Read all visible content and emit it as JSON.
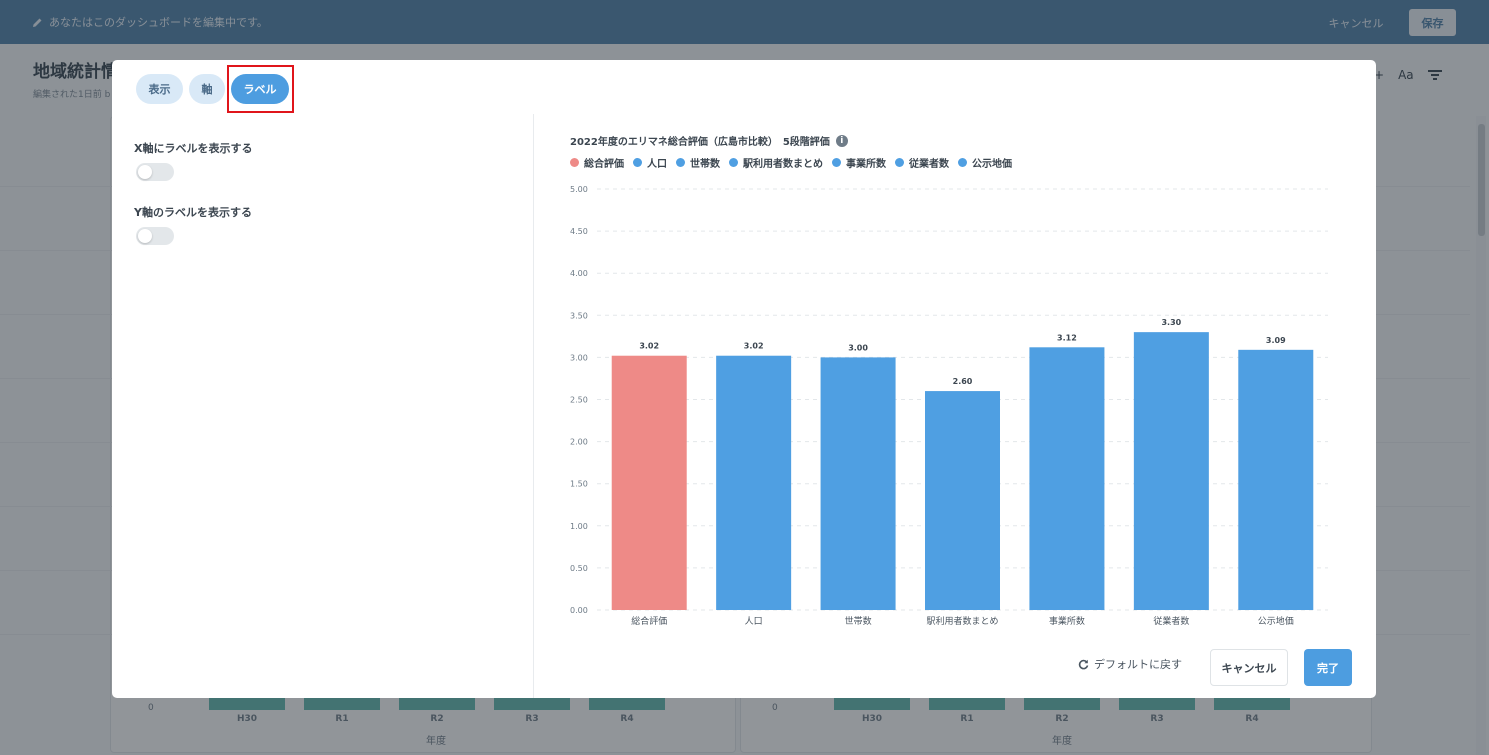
{
  "top_bar": {
    "edit_message": "あなたはこのダッシュボードを編集中です。",
    "cancel_label": "キャンセル",
    "save_label": "保存"
  },
  "background": {
    "title": "地域統計情",
    "subtitle": "編集された1日前 b",
    "tools": {
      "text_label": "Aa"
    },
    "chart_ticks": [
      "H30",
      "R1",
      "R2",
      "R3",
      "R4"
    ],
    "axis_zero": "0",
    "axis_title": "年度"
  },
  "modal": {
    "tabs": [
      {
        "label": "表示",
        "active": false
      },
      {
        "label": "軸",
        "active": false
      },
      {
        "label": "ラベル",
        "active": true
      }
    ],
    "options": [
      {
        "label": "X軸にラベルを表示する",
        "enabled": false
      },
      {
        "label": "Y軸のラベルを表示する",
        "enabled": false
      }
    ],
    "footer": {
      "reset_label": "デフォルトに戻す",
      "cancel_label": "キャンセル",
      "done_label": "完了"
    }
  },
  "colors": {
    "header": "#4d7ea7",
    "accent": "#4d9de0",
    "series_total": "#ee8a87",
    "series_other": "#4f9fe2",
    "highlight": "#e0151b"
  },
  "chart_data": {
    "type": "bar",
    "title": "2022年度のエリマネ総合評価（広島市比較）　5段階評価",
    "categories": [
      "総合評価",
      "人口",
      "世帯数",
      "駅利用者数まとめ",
      "事業所数",
      "従業者数",
      "公示地価"
    ],
    "values": [
      3.02,
      3.02,
      3.0,
      2.6,
      3.12,
      3.3,
      3.09
    ],
    "value_labels": [
      "3.02",
      "3.02",
      "3.00",
      "2.60",
      "3.12",
      "3.30",
      "3.09"
    ],
    "legend": [
      "総合評価",
      "人口",
      "世帯数",
      "駅利用者数まとめ",
      "事業所数",
      "従業者数",
      "公示地価"
    ],
    "bar_colors": [
      "#ee8a87",
      "#4f9fe2",
      "#4f9fe2",
      "#4f9fe2",
      "#4f9fe2",
      "#4f9fe2",
      "#4f9fe2"
    ],
    "y_ticks": [
      "0.00",
      "0.50",
      "1.00",
      "1.50",
      "2.00",
      "2.50",
      "3.00",
      "3.50",
      "4.00",
      "4.50",
      "5.00"
    ],
    "ylim": [
      0,
      5
    ],
    "grid": true,
    "legend_position": "top-left",
    "xlabel": "",
    "ylabel": ""
  }
}
